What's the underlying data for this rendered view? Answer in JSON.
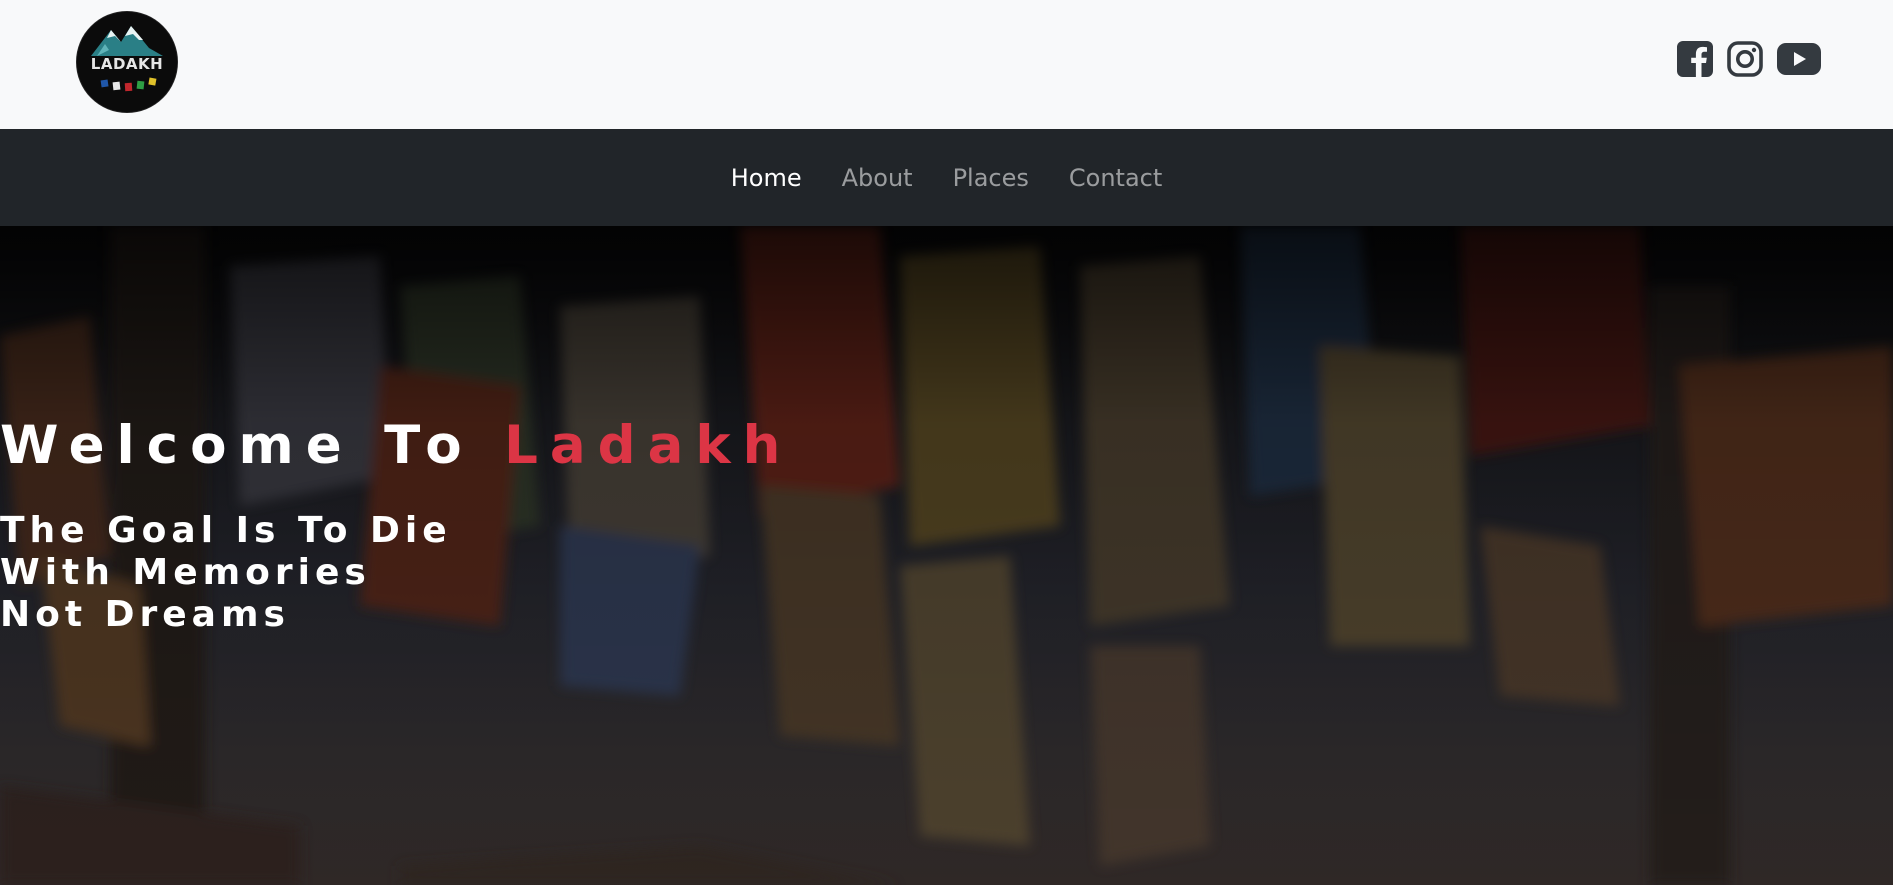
{
  "brand": {
    "logo_text": "LADAKH",
    "logo_icon": "mountain-logo-icon"
  },
  "social": [
    {
      "name": "facebook-icon"
    },
    {
      "name": "instagram-icon"
    },
    {
      "name": "youtube-icon"
    }
  ],
  "nav": {
    "items": [
      {
        "label": "Home",
        "active": true
      },
      {
        "label": "About"
      },
      {
        "label": "Places"
      },
      {
        "label": "Contact"
      }
    ]
  },
  "hero": {
    "title_main": "Welcome To ",
    "title_accent": "Ladakh",
    "subtitle_lines": [
      "The Goal Is To Die",
      "With Memories",
      "Not Dreams"
    ]
  },
  "colors": {
    "topbar_bg": "#f8f9fa",
    "nav_bg": "#212529",
    "accent": "#dc3545",
    "icon": "#343a40"
  }
}
